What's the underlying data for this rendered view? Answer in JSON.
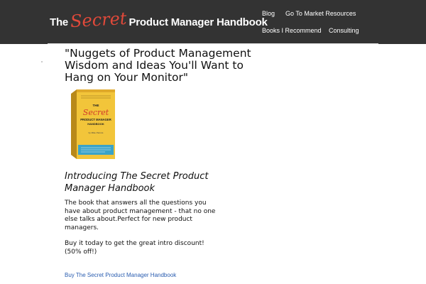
{
  "header": {
    "logo": {
      "pre": "The",
      "accent": "Secret",
      "post": "Product Manager Handbook"
    },
    "nav": [
      "Blog",
      "Go To Market Resources",
      "Books I Recommend",
      "Consulting"
    ]
  },
  "main": {
    "headline": "\"Nuggets of Product Management Wisdom and Ideas You'll Want to Hang on Your Monitor\"",
    "book_cover": {
      "title_line1": "THE",
      "title_accent": "Secret",
      "title_line2": "PRODUCT MANAGER",
      "title_line3": "HANDBOOK",
      "author": "by Mike Parrots"
    },
    "subheading": "Introducing The Secret Product Manager Handbook",
    "description": "The book that answers all the questions you have about product management - that no one else talks about.Perfect for new product managers.",
    "promo": "Buy it today to get the great intro discount! (50% off!)",
    "buy_link": "Buy The Secret Product Manager Handbook"
  },
  "colors": {
    "header_bg": "#333333",
    "accent_red": "#e0493a",
    "link_blue": "#2a5db0",
    "book_yellow": "#f2c53a"
  }
}
